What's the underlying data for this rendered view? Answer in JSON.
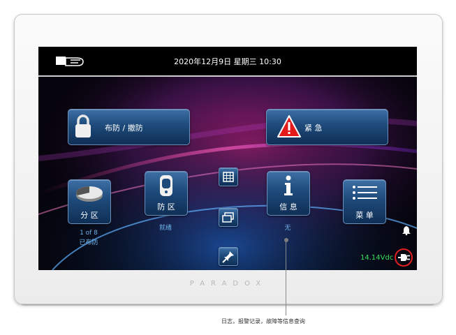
{
  "status_bar": {
    "datetime": "2020年12月9日 星期三 10:30",
    "status_icon": "hand-touch-icon"
  },
  "buttons": {
    "arm_disarm": {
      "label": "布防 / 撤防",
      "icon": "padlock-icon"
    },
    "panic": {
      "label": "紧 急",
      "icon": "warning-triangle-icon"
    },
    "areas": {
      "label": "分 区",
      "icon": "pie-chart-icon",
      "caption_line1": "1 of 8",
      "caption_line2": "已布防"
    },
    "zones": {
      "label": "防 区",
      "icon": "sensor-icon",
      "caption": "就绪"
    },
    "info": {
      "label": "信 息",
      "icon": "info-icon",
      "caption": "无"
    },
    "menu": {
      "label": "菜 单",
      "icon": "menu-list-icon"
    },
    "small": [
      "grid-icon",
      "windows-icon",
      "pin-icon"
    ]
  },
  "power": {
    "voltage": "14.14Vdc",
    "plug_icon": "plug-icon",
    "bell_icon": "bell-icon"
  },
  "brand": "PARADOX",
  "callout": "日志，报警记录，故障等信息查询",
  "colors": {
    "button": "#1e4a7a",
    "voltage_text": "#39e05a",
    "caption_text": "#6fb3e8",
    "alert_ring": "#e02020"
  }
}
